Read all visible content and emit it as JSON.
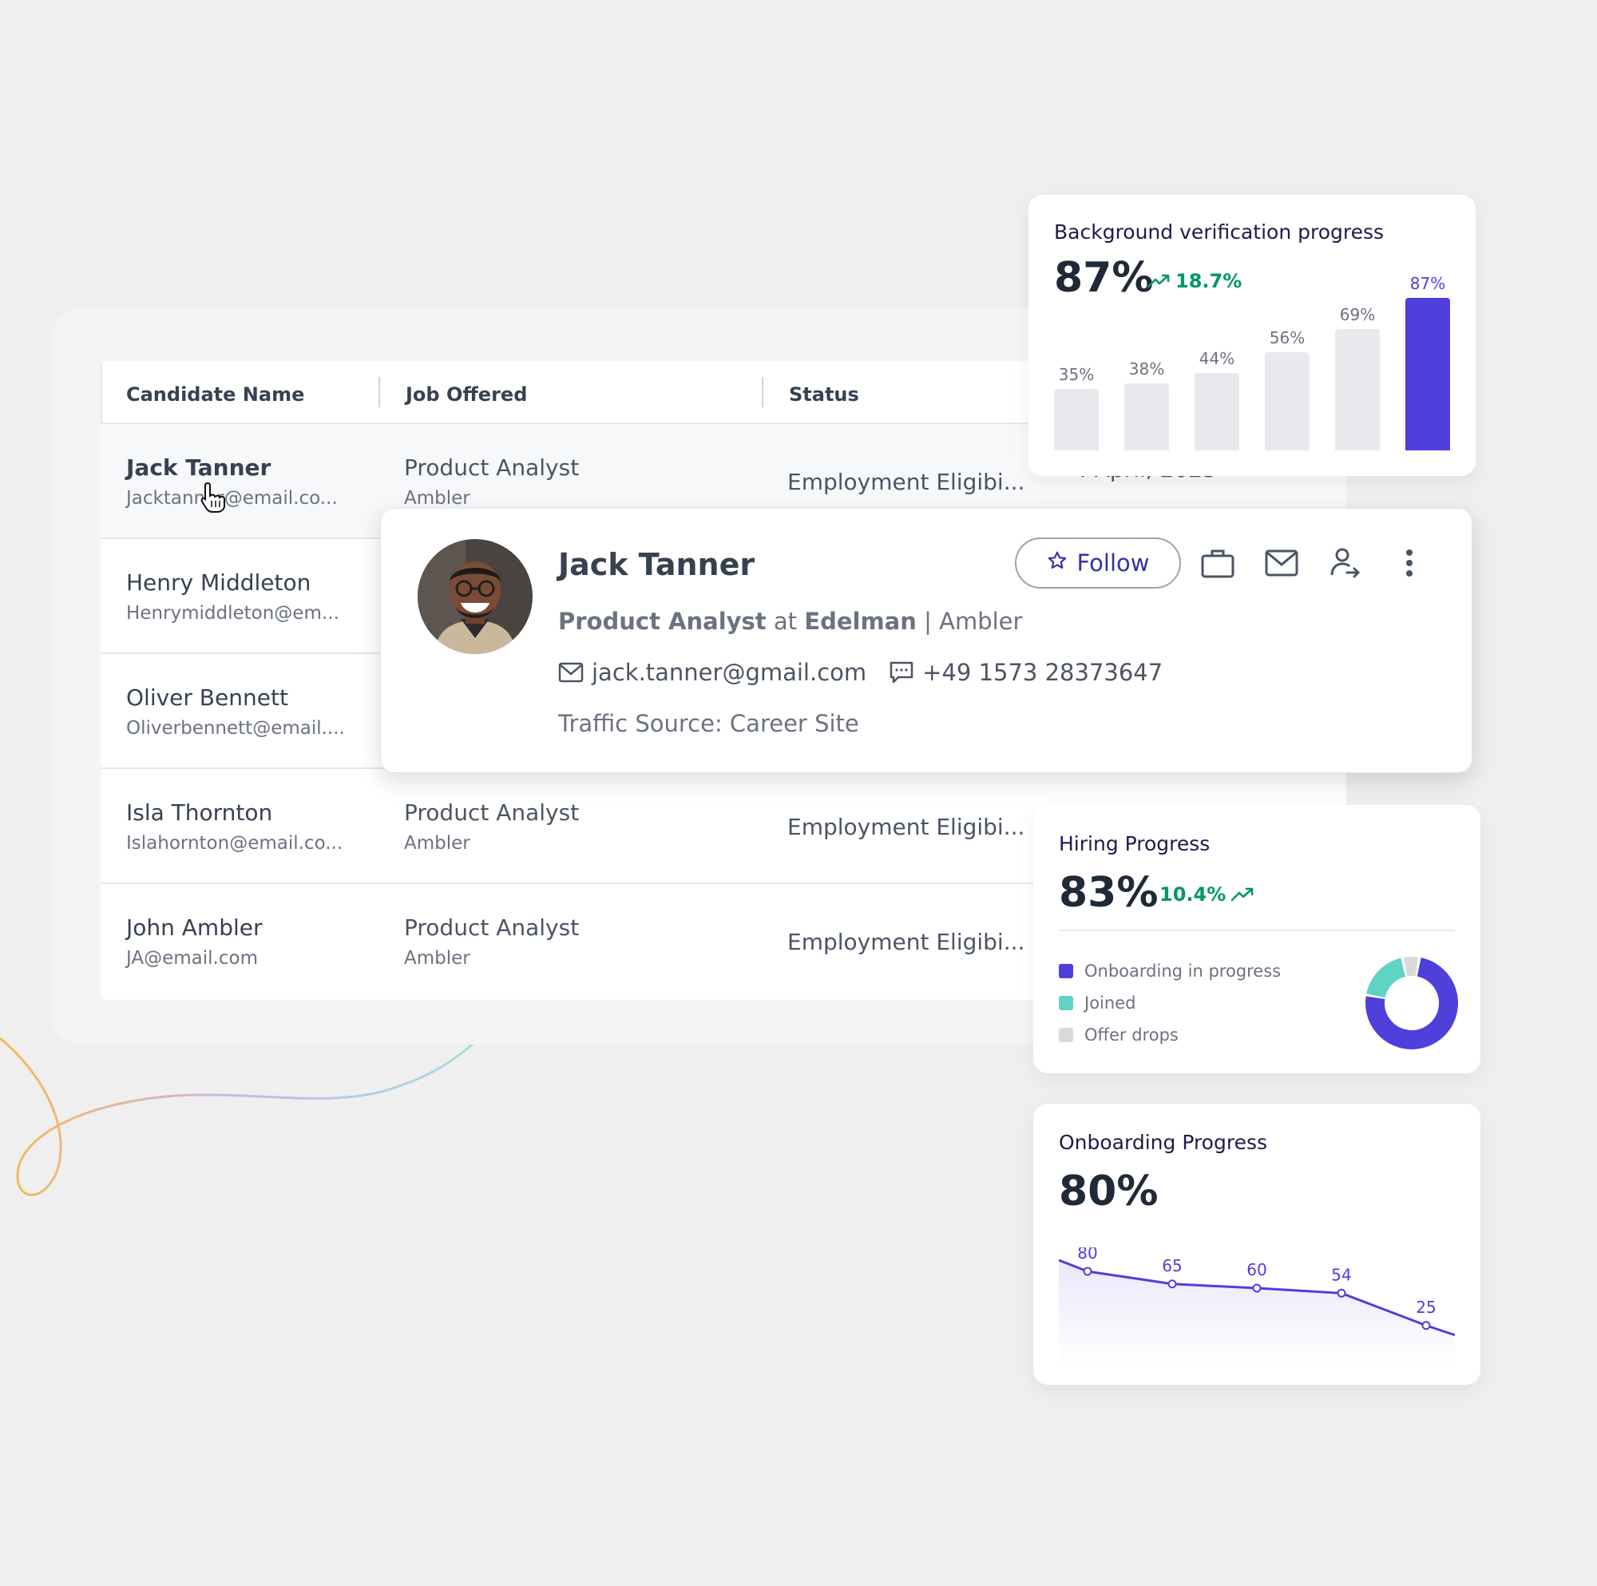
{
  "table": {
    "headers": {
      "name": "Candidate Name",
      "job": "Job Offered",
      "status": "Status"
    },
    "rows": [
      {
        "name": "Jack Tanner",
        "email": "Jacktanner@email.co...",
        "job": "Product Analyst",
        "company": "Ambler",
        "status": "Employment Eligibi...",
        "date": "4 April, 2025"
      },
      {
        "name": "Henry Middleton",
        "email": "Henrymiddleton@em..."
      },
      {
        "name": "Oliver Bennett",
        "email": "Oliverbennett@email...."
      },
      {
        "name": "Isla Thornton",
        "email": "Islahornton@email.co...",
        "job": "Product Analyst",
        "company": "Ambler",
        "status": "Employment Eligibi..."
      },
      {
        "name": "John Ambler",
        "email": "JA@email.com",
        "job": "Product Analyst",
        "company": "Ambler",
        "status": "Employment Eligibi..."
      }
    ]
  },
  "profile": {
    "name": "Jack Tanner",
    "role": "Product Analyst",
    "at": "at",
    "company": "Edelman",
    "separator": "|",
    "client": "Ambler",
    "email": "jack.tanner@gmail.com",
    "phone": "+49 1573 28373647",
    "traffic_source": "Traffic Source: Career Site",
    "follow_label": "Follow",
    "actions": [
      "briefcase-icon",
      "mail-icon",
      "transfer-user-icon",
      "more-vertical-icon"
    ]
  },
  "bgv_card": {
    "title": "Background verification progress",
    "value": "87%",
    "delta": "18.7%",
    "accent": "#4f3fdb",
    "delta_color": "#059669"
  },
  "hiring_card": {
    "title": "Hiring Progress",
    "value": "83%",
    "delta": "10.4%",
    "legend": [
      "Onboarding in progress",
      "Joined",
      "Offer drops"
    ],
    "colors": [
      "#4f3fdb",
      "#5fd3c4",
      "#d9dadd"
    ]
  },
  "onboarding_card": {
    "title": "Onboarding Progress",
    "value": "80%"
  },
  "chart_data": [
    {
      "type": "bar",
      "title": "Background verification progress",
      "categories": [
        "1",
        "2",
        "3",
        "4",
        "5",
        "6"
      ],
      "values": [
        35,
        38,
        44,
        56,
        69,
        87
      ],
      "labels": [
        "35%",
        "38%",
        "44%",
        "56%",
        "69%",
        "87%"
      ],
      "highlight_index": 5,
      "ylim": [
        0,
        100
      ]
    },
    {
      "type": "pie",
      "title": "Hiring Progress",
      "series": [
        {
          "name": "Onboarding in progress",
          "values": [
            75
          ]
        },
        {
          "name": "Joined",
          "values": [
            19
          ]
        },
        {
          "name": "Offer drops",
          "values": [
            6
          ]
        }
      ]
    },
    {
      "type": "line",
      "title": "Onboarding Progress",
      "x": [
        1,
        2,
        3,
        4,
        5
      ],
      "values": [
        80,
        65,
        60,
        54,
        25
      ],
      "labels": [
        "80",
        "65",
        "60",
        "54",
        "25"
      ]
    }
  ]
}
